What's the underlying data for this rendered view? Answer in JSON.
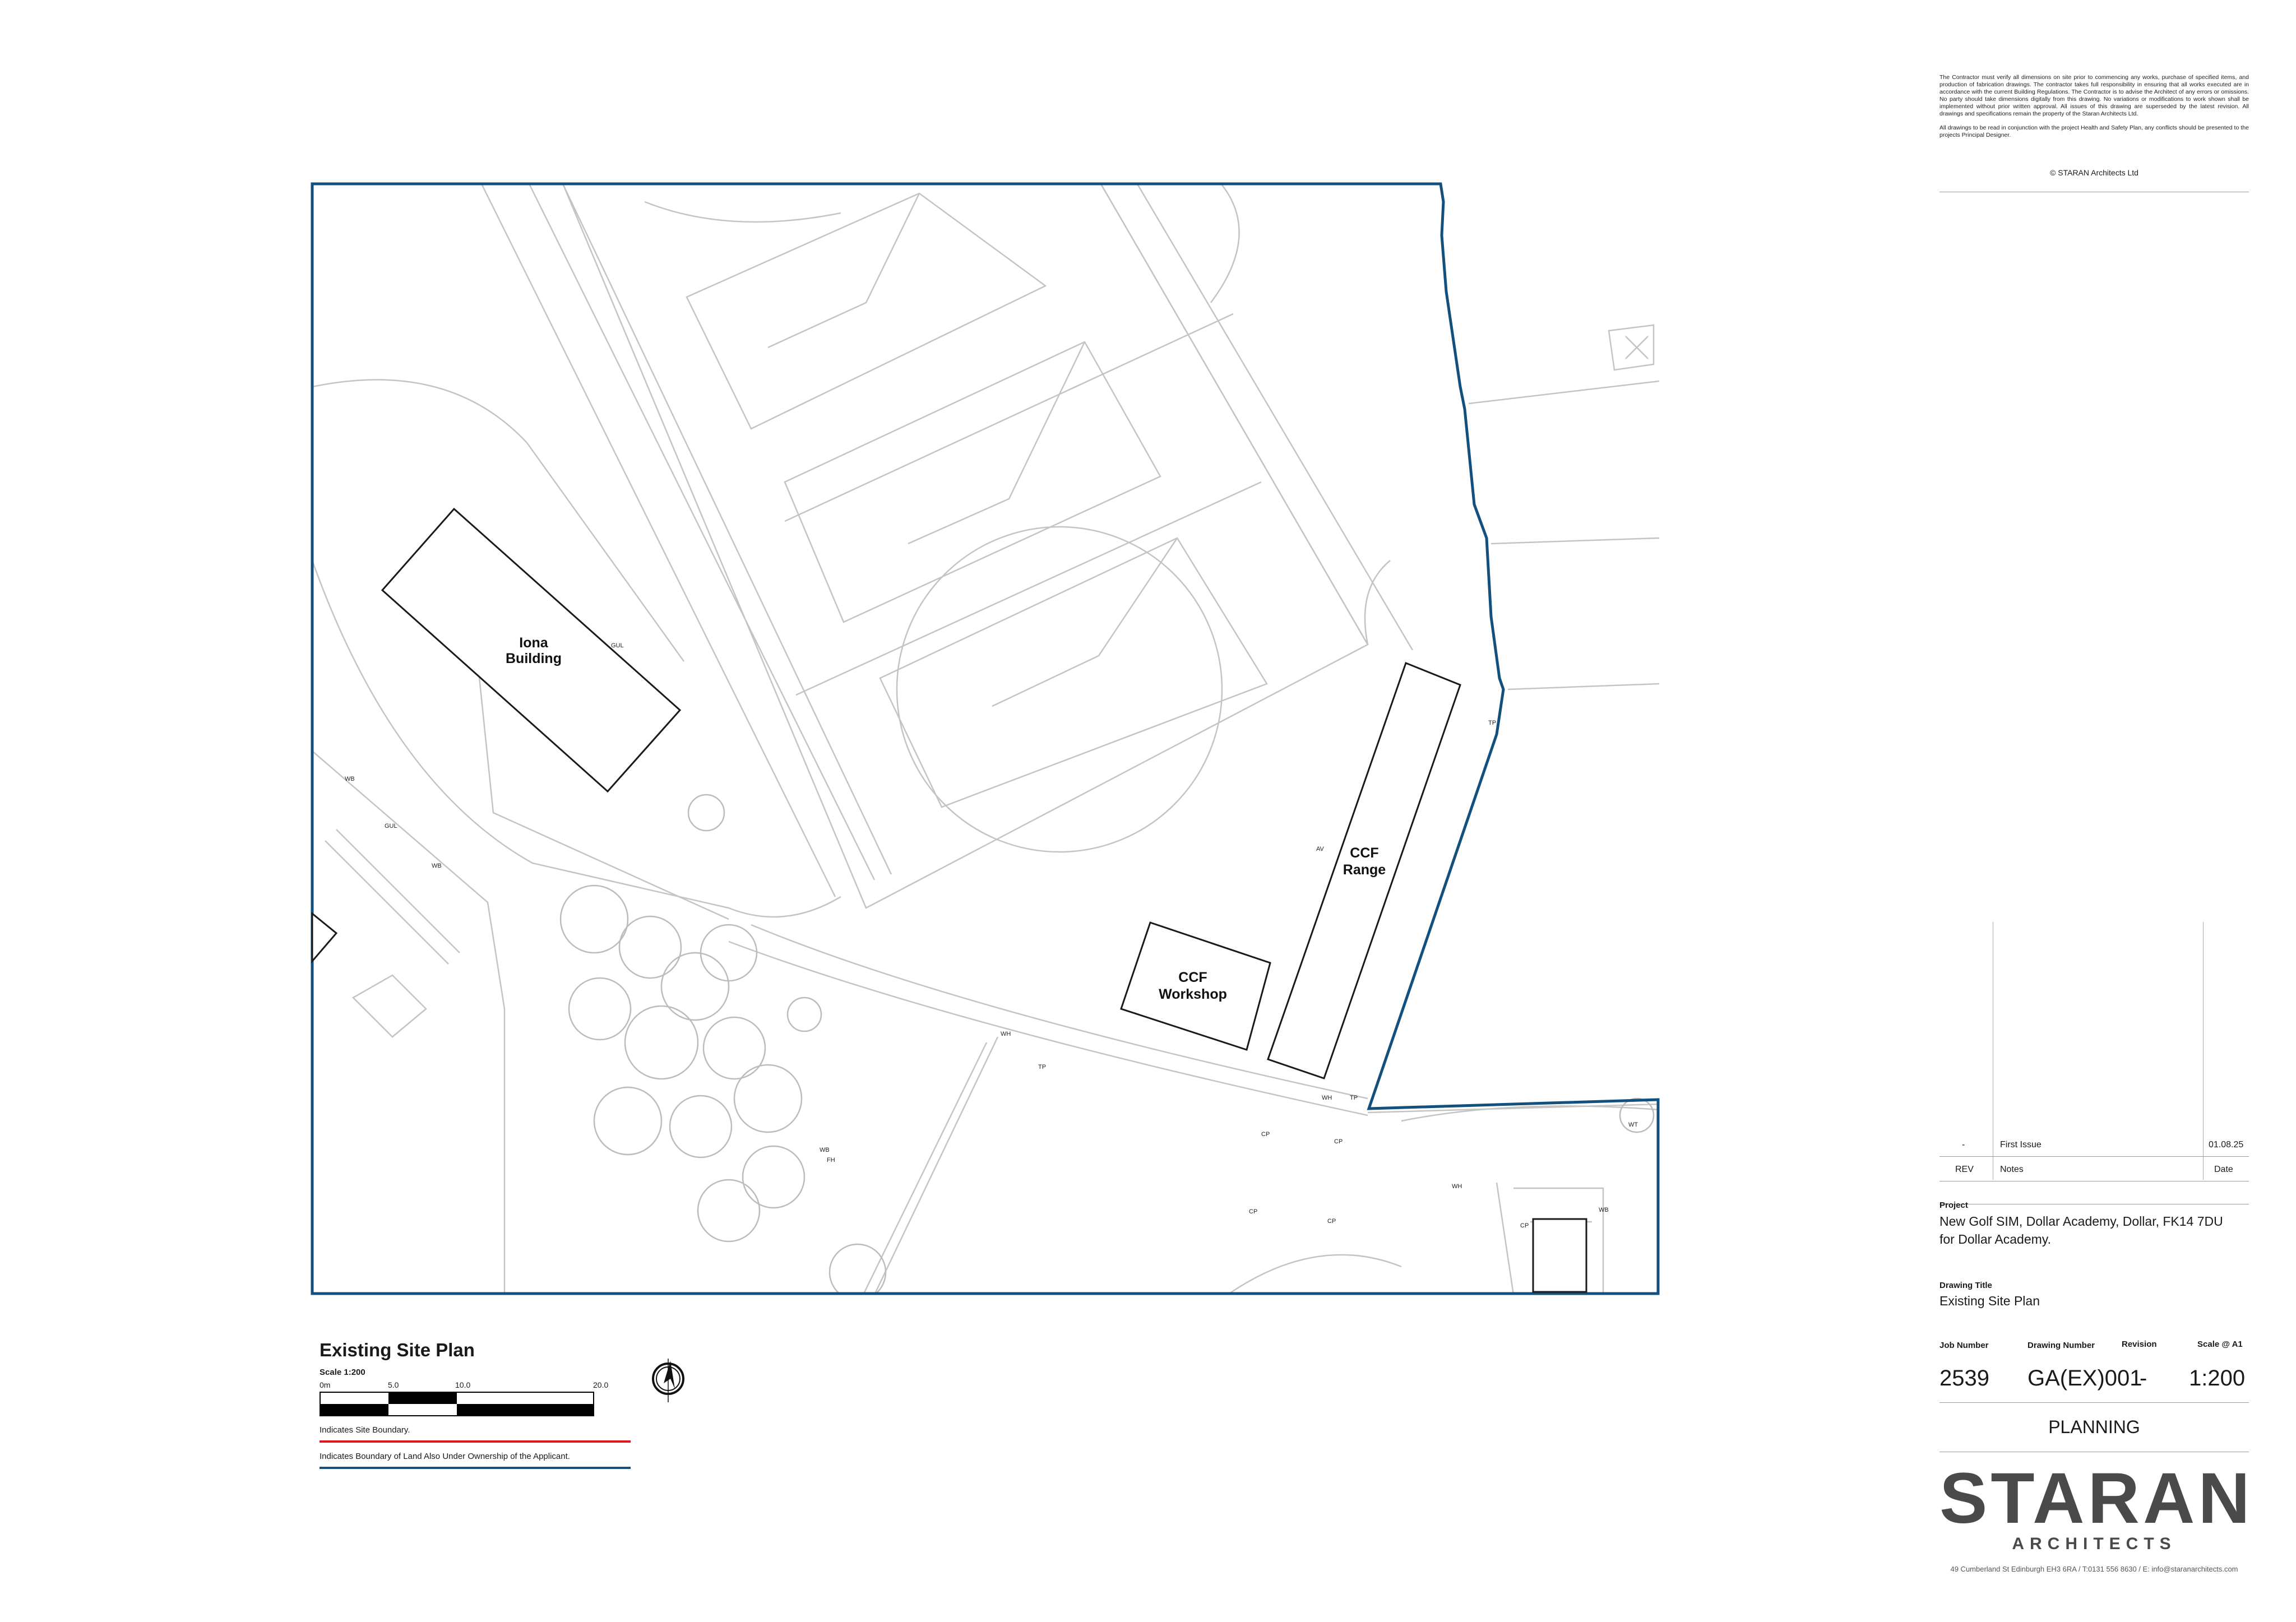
{
  "plan": {
    "buildings": [
      {
        "name": "Iona Building",
        "line1": "Iona",
        "line2": "Building"
      },
      {
        "name": "CCF Range",
        "line1": "CCF",
        "line2": "Range"
      },
      {
        "name": "CCF Workshop",
        "line1": "CCF",
        "line2": "Workshop"
      }
    ],
    "annotations": [
      "WH",
      "GUL",
      "WB",
      "WB",
      "TP",
      "TP",
      "AV",
      "WH",
      "TP",
      "WH",
      "CP",
      "CP",
      "CP",
      "CP",
      "WT",
      "WB",
      "FH",
      "CP",
      "WB",
      "GUL"
    ]
  },
  "legend": {
    "title": "Existing Site Plan",
    "scale_label": "Scale 1:200",
    "ticks": [
      "0m",
      "5.0",
      "10.0",
      "20.0"
    ],
    "site_boundary": "Indicates Site Boundary.",
    "ownership_boundary": "Indicates Boundary of Land Also Under Ownership of the Applicant.",
    "colors": {
      "site_boundary": "#e3131b",
      "ownership_boundary": "#14507e"
    }
  },
  "north_arrow": {
    "icon": "north-arrow-icon"
  },
  "title_block": {
    "notes": [
      "The Contractor must verify all dimensions on site prior to commencing any works, purchase of specified items, and production of fabrication drawings.  The contractor takes full responsibility in ensuring that all works executed are in accordance with the current Building Regulations. The Contractor is to advise the Architect of any errors or omissions.  No party should take dimensions digitally from this drawing.  No variations or modifications to work shown shall be implemented without prior written approval.  All issues of this drawing are superseded by the latest revision.  All drawings and specifications remain the property of the Staran Architects Ltd.",
      "All drawings to be read in conjunction with the project Health and Safety Plan, any conflicts should be presented to the projects Principal Designer."
    ],
    "copyright": "© STARAN Architects Ltd",
    "revisions": [
      {
        "rev": "-",
        "notes": "First Issue",
        "date": "01.08.25"
      }
    ],
    "rev_headers": {
      "rev": "REV",
      "notes": "Notes",
      "date": "Date"
    },
    "project_label": "Project",
    "project_line1": "New Golf SIM, Dollar Academy, Dollar, FK14 7DU",
    "project_line2": "for Dollar Academy.",
    "drawing_title_label": "Drawing Title",
    "drawing_title": "Existing Site Plan",
    "headers": {
      "job": "Job Number",
      "drawing": "Drawing Number",
      "revision": "Revision",
      "scale": "Scale @ A1"
    },
    "job_number": "2539",
    "drawing_number": "GA(EX)001",
    "revision": "-",
    "scale": "1:200",
    "status": "PLANNING",
    "logo": "STARAN",
    "logo_sub": "ARCHITECTS",
    "address": "49 Cumberland St Edinburgh EH3 6RA  /  T:0131 556 8630  /  E: info@staranarchitects.com"
  }
}
